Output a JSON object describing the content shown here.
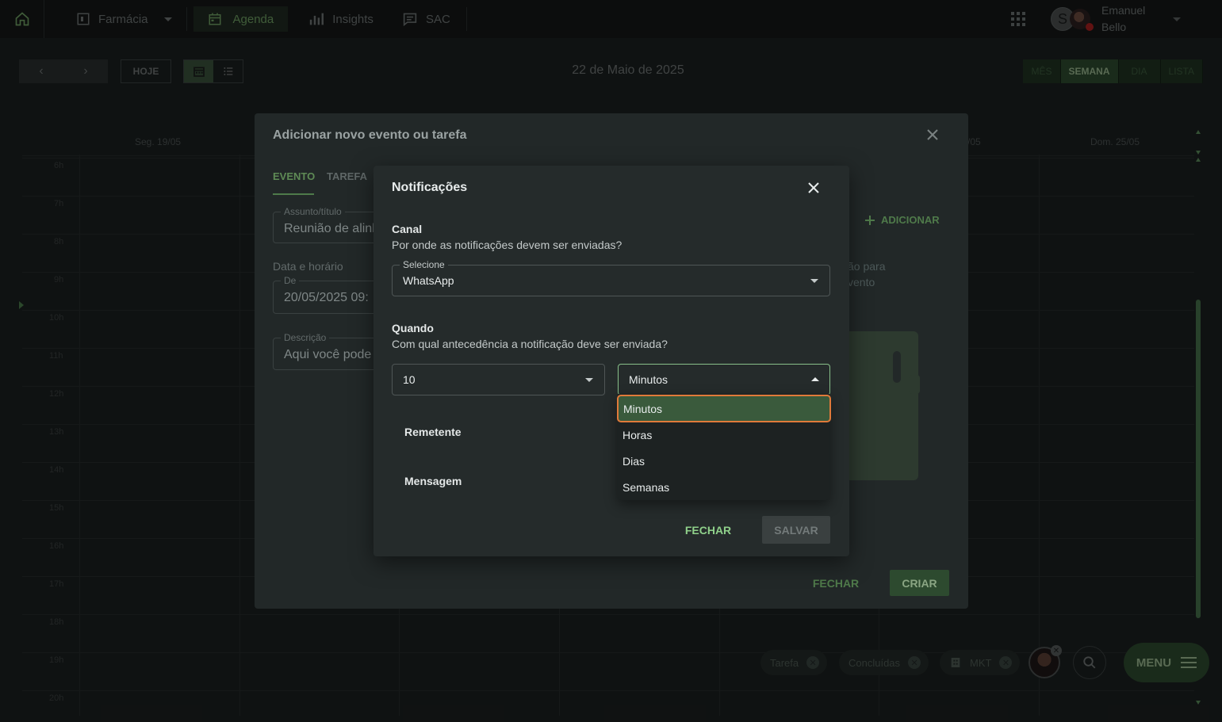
{
  "nav": {
    "items": [
      {
        "label": "Farmácia",
        "icon": "store-icon",
        "has_caret": true
      },
      {
        "label": "Agenda",
        "icon": "calendar-icon",
        "active": true
      },
      {
        "label": "Insights",
        "icon": "bar-chart-icon"
      },
      {
        "label": "SAC",
        "icon": "chat-icon"
      }
    ],
    "user": {
      "initial": "S",
      "first_name": "Emanuel",
      "last_name": "Bello"
    }
  },
  "toolbar": {
    "prev": "‹",
    "next": "›",
    "today": "HOJE",
    "date_title": "22 de Maio de 2025",
    "periods": [
      "MÊS",
      "SEMANA",
      "DIA",
      "LISTA"
    ],
    "active_period": "SEMANA"
  },
  "calendar": {
    "day_headers": [
      "Seg. 19/05",
      "/05",
      "Dom. 25/05"
    ],
    "hours": [
      "6h",
      "7h",
      "8h",
      "9h",
      "10h",
      "11h",
      "12h",
      "13h",
      "14h",
      "15h",
      "16h",
      "17h",
      "18h",
      "19h",
      "20h"
    ]
  },
  "event_dialog": {
    "title": "Adicionar novo evento ou tarefa",
    "tabs": [
      "EVENTO",
      "TAREFA"
    ],
    "subject_label": "Assunto/título",
    "subject_value": "Reunião de alinl",
    "datetime_label": "Data e horário",
    "from_label": "De",
    "from_value": "20/05/2025 09:",
    "description_label": "Descrição",
    "description_value": "Aqui você pode",
    "add_label": "ADICIONAR",
    "side_text_1": "ão para",
    "side_text_2": "vento",
    "close_label": "FECHAR",
    "create_label": "CRIAR"
  },
  "notif_dialog": {
    "title": "Notificações",
    "channel_title": "Canal",
    "channel_subtitle": "Por onde as notificações devem ser enviadas?",
    "channel_select_label": "Selecione",
    "channel_value": "WhatsApp",
    "when_title": "Quando",
    "when_subtitle": "Com qual antecedência a notificação deve ser enviada?",
    "amount_value": "10",
    "unit_value": "Minutos",
    "sender_label": "Remetente",
    "message_label": "Mensagem",
    "close_label": "FECHAR",
    "save_label": "SALVAR"
  },
  "unit_menu": {
    "options": [
      "Minutos",
      "Horas",
      "Dias",
      "Semanas"
    ],
    "selected": "Minutos"
  },
  "filters": {
    "chips": [
      "Tarefa",
      "Concluídas",
      "MKT"
    ],
    "menu_label": "MENU"
  },
  "colors": {
    "accent_green": "#6f9f63",
    "focus_outline": "#e07a3a",
    "selected_bg": "#3a5a3c"
  }
}
